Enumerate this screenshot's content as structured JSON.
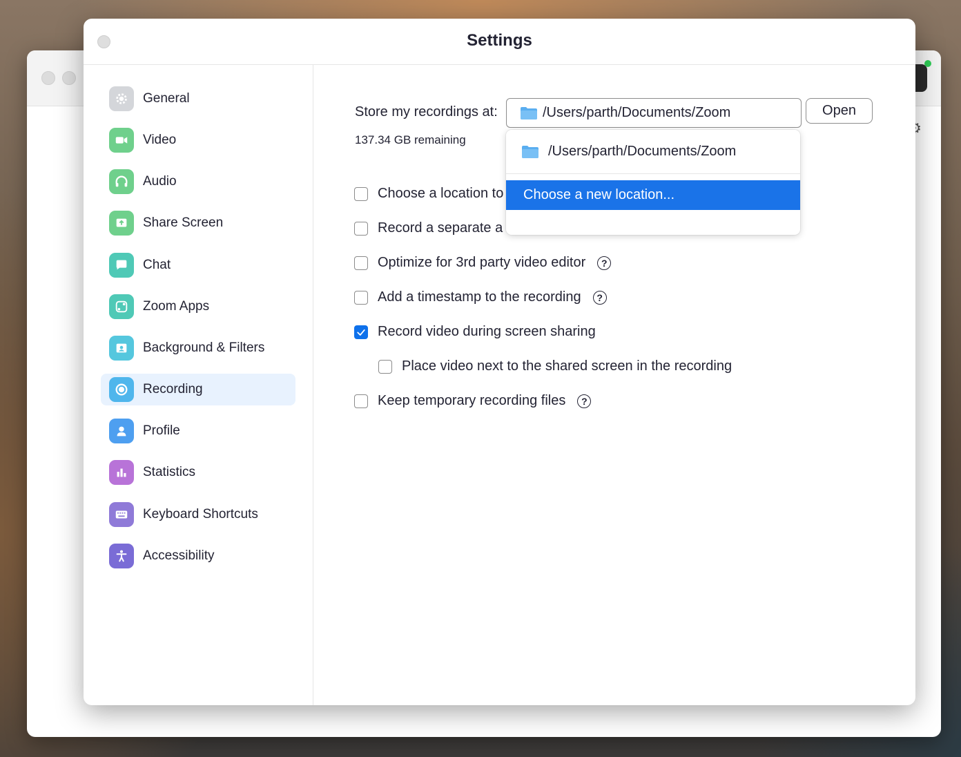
{
  "window": {
    "title": "Settings"
  },
  "sidebar": {
    "items": [
      {
        "label": "General",
        "icon": "gear-icon",
        "color": "#d4d6da",
        "active": false
      },
      {
        "label": "Video",
        "icon": "video-camera-icon",
        "color": "#6fd08c",
        "active": false
      },
      {
        "label": "Audio",
        "icon": "headphones-icon",
        "color": "#6fd08c",
        "active": false
      },
      {
        "label": "Share Screen",
        "icon": "share-screen-icon",
        "color": "#6fd08c",
        "active": false
      },
      {
        "label": "Chat",
        "icon": "chat-bubble-icon",
        "color": "#4fc9b6",
        "active": false
      },
      {
        "label": "Zoom Apps",
        "icon": "zoom-apps-icon",
        "color": "#4fc9b6",
        "active": false
      },
      {
        "label": "Background & Filters",
        "icon": "background-icon",
        "color": "#55c7de",
        "active": false
      },
      {
        "label": "Recording",
        "icon": "record-icon",
        "color": "#4fb6ec",
        "active": true
      },
      {
        "label": "Profile",
        "icon": "profile-icon",
        "color": "#4e9ff0",
        "active": false
      },
      {
        "label": "Statistics",
        "icon": "bar-chart-icon",
        "color": "#b873d8",
        "active": false
      },
      {
        "label": "Keyboard Shortcuts",
        "icon": "keyboard-icon",
        "color": "#8f7ad8",
        "active": false
      },
      {
        "label": "Accessibility",
        "icon": "accessibility-icon",
        "color": "#7a6cd6",
        "active": false
      }
    ]
  },
  "recording": {
    "store_label": "Store my recordings at:",
    "path": "/Users/parth/Documents/Zoom",
    "open_label": "Open",
    "remaining": "137.34 GB remaining",
    "options": [
      {
        "label": "Choose a location to",
        "checked": false,
        "help": false,
        "indent": false
      },
      {
        "label": "Record a separate a",
        "checked": false,
        "help": false,
        "indent": false
      },
      {
        "label": "Optimize for 3rd party video editor",
        "checked": false,
        "help": true,
        "indent": false
      },
      {
        "label": "Add a timestamp to the recording",
        "checked": false,
        "help": true,
        "indent": false
      },
      {
        "label": "Record video during screen sharing",
        "checked": true,
        "help": false,
        "indent": false
      },
      {
        "label": "Place video next to the shared screen in the recording",
        "checked": false,
        "help": false,
        "indent": true
      },
      {
        "label": "Keep temporary recording files",
        "checked": false,
        "help": true,
        "indent": false
      }
    ],
    "dropdown": {
      "path": "/Users/parth/Documents/Zoom",
      "choose_label": "Choose a new location..."
    }
  },
  "help_glyph": "?",
  "colors": {
    "accent": "#0e71eb",
    "highlight": "#1a73e8",
    "active_bg": "#e8f2fe"
  }
}
